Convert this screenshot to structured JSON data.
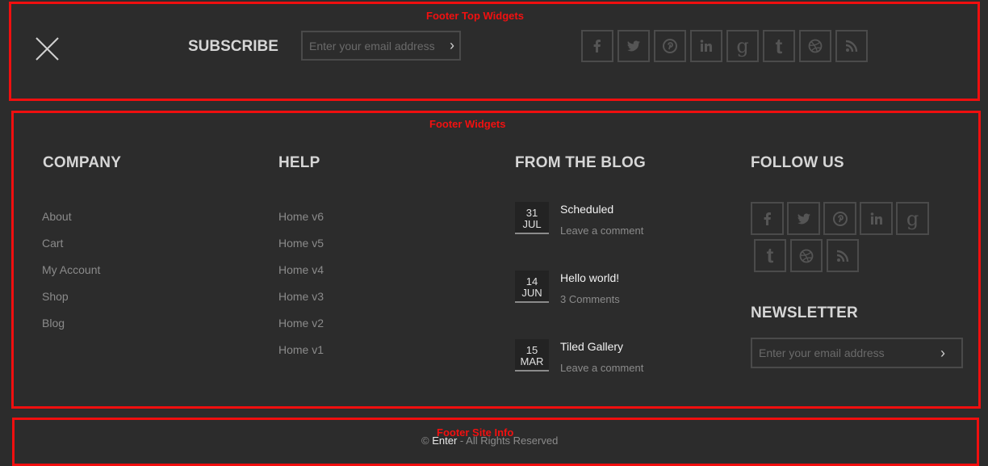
{
  "annotations": {
    "top": "Footer Top Widgets",
    "widgets": "Footer Widgets",
    "site_info": "Footer Site Info"
  },
  "top_bar": {
    "subscribe_label": "SUBSCRIBE",
    "email_placeholder": "Enter your email address",
    "social": [
      "facebook-icon",
      "twitter-icon",
      "pinterest-icon",
      "linkedin-icon",
      "google-plus-icon",
      "tumblr-icon",
      "dribbble-icon",
      "rss-icon"
    ]
  },
  "company": {
    "title": "COMPANY",
    "links": [
      "About",
      "Cart",
      "My Account",
      "Shop",
      "Blog"
    ]
  },
  "help": {
    "title": "HELP",
    "links": [
      "Home v6",
      "Home v5",
      "Home v4",
      "Home v3",
      "Home v2",
      "Home v1"
    ]
  },
  "blog": {
    "title": "FROM THE BLOG",
    "posts": [
      {
        "day": "31",
        "month": "JUL",
        "title": "Scheduled",
        "meta": "Leave a comment"
      },
      {
        "day": "14",
        "month": "JUN",
        "title": "Hello world!",
        "meta": "3 Comments"
      },
      {
        "day": "15",
        "month": "MAR",
        "title": "Tiled Gallery",
        "meta": "Leave a comment"
      }
    ]
  },
  "follow": {
    "title": "FOLLOW US",
    "social": [
      "facebook-icon",
      "twitter-icon",
      "pinterest-icon",
      "linkedin-icon",
      "google-plus-icon",
      "tumblr-icon",
      "dribbble-icon",
      "rss-icon"
    ]
  },
  "newsletter": {
    "title": "NEWSLETTER",
    "placeholder": "Enter your email address"
  },
  "site_info": {
    "copyright_symbol": "©",
    "brand": "Enter",
    "rights": "- All Rights Reserved"
  },
  "colors": {
    "background": "#2c2c2c",
    "annotation": "#f00f0f",
    "icon_border": "#4b4b4b"
  }
}
